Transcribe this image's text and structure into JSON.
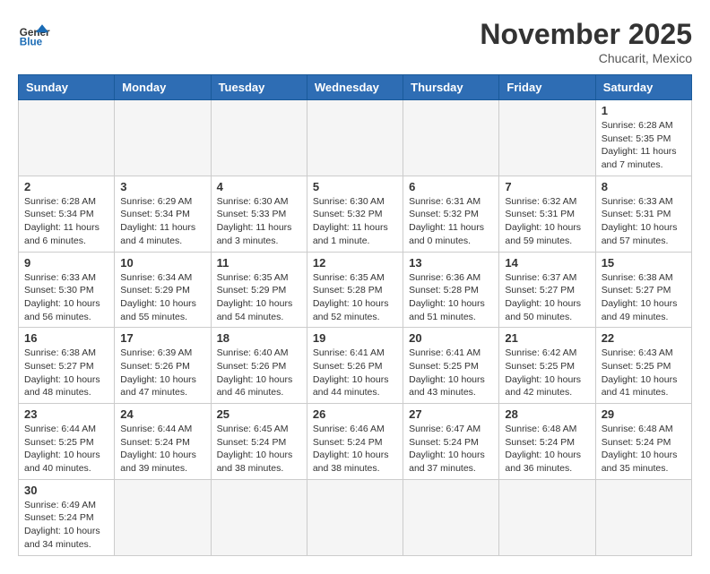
{
  "header": {
    "logo_general": "General",
    "logo_blue": "Blue",
    "month": "November 2025",
    "location": "Chucarit, Mexico"
  },
  "weekdays": [
    "Sunday",
    "Monday",
    "Tuesday",
    "Wednesday",
    "Thursday",
    "Friday",
    "Saturday"
  ],
  "weeks": [
    [
      {
        "day": "",
        "info": ""
      },
      {
        "day": "",
        "info": ""
      },
      {
        "day": "",
        "info": ""
      },
      {
        "day": "",
        "info": ""
      },
      {
        "day": "",
        "info": ""
      },
      {
        "day": "",
        "info": ""
      },
      {
        "day": "1",
        "info": "Sunrise: 6:28 AM\nSunset: 5:35 PM\nDaylight: 11 hours and 7 minutes."
      }
    ],
    [
      {
        "day": "2",
        "info": "Sunrise: 6:28 AM\nSunset: 5:34 PM\nDaylight: 11 hours and 6 minutes."
      },
      {
        "day": "3",
        "info": "Sunrise: 6:29 AM\nSunset: 5:34 PM\nDaylight: 11 hours and 4 minutes."
      },
      {
        "day": "4",
        "info": "Sunrise: 6:30 AM\nSunset: 5:33 PM\nDaylight: 11 hours and 3 minutes."
      },
      {
        "day": "5",
        "info": "Sunrise: 6:30 AM\nSunset: 5:32 PM\nDaylight: 11 hours and 1 minute."
      },
      {
        "day": "6",
        "info": "Sunrise: 6:31 AM\nSunset: 5:32 PM\nDaylight: 11 hours and 0 minutes."
      },
      {
        "day": "7",
        "info": "Sunrise: 6:32 AM\nSunset: 5:31 PM\nDaylight: 10 hours and 59 minutes."
      },
      {
        "day": "8",
        "info": "Sunrise: 6:33 AM\nSunset: 5:31 PM\nDaylight: 10 hours and 57 minutes."
      }
    ],
    [
      {
        "day": "9",
        "info": "Sunrise: 6:33 AM\nSunset: 5:30 PM\nDaylight: 10 hours and 56 minutes."
      },
      {
        "day": "10",
        "info": "Sunrise: 6:34 AM\nSunset: 5:29 PM\nDaylight: 10 hours and 55 minutes."
      },
      {
        "day": "11",
        "info": "Sunrise: 6:35 AM\nSunset: 5:29 PM\nDaylight: 10 hours and 54 minutes."
      },
      {
        "day": "12",
        "info": "Sunrise: 6:35 AM\nSunset: 5:28 PM\nDaylight: 10 hours and 52 minutes."
      },
      {
        "day": "13",
        "info": "Sunrise: 6:36 AM\nSunset: 5:28 PM\nDaylight: 10 hours and 51 minutes."
      },
      {
        "day": "14",
        "info": "Sunrise: 6:37 AM\nSunset: 5:27 PM\nDaylight: 10 hours and 50 minutes."
      },
      {
        "day": "15",
        "info": "Sunrise: 6:38 AM\nSunset: 5:27 PM\nDaylight: 10 hours and 49 minutes."
      }
    ],
    [
      {
        "day": "16",
        "info": "Sunrise: 6:38 AM\nSunset: 5:27 PM\nDaylight: 10 hours and 48 minutes."
      },
      {
        "day": "17",
        "info": "Sunrise: 6:39 AM\nSunset: 5:26 PM\nDaylight: 10 hours and 47 minutes."
      },
      {
        "day": "18",
        "info": "Sunrise: 6:40 AM\nSunset: 5:26 PM\nDaylight: 10 hours and 46 minutes."
      },
      {
        "day": "19",
        "info": "Sunrise: 6:41 AM\nSunset: 5:26 PM\nDaylight: 10 hours and 44 minutes."
      },
      {
        "day": "20",
        "info": "Sunrise: 6:41 AM\nSunset: 5:25 PM\nDaylight: 10 hours and 43 minutes."
      },
      {
        "day": "21",
        "info": "Sunrise: 6:42 AM\nSunset: 5:25 PM\nDaylight: 10 hours and 42 minutes."
      },
      {
        "day": "22",
        "info": "Sunrise: 6:43 AM\nSunset: 5:25 PM\nDaylight: 10 hours and 41 minutes."
      }
    ],
    [
      {
        "day": "23",
        "info": "Sunrise: 6:44 AM\nSunset: 5:25 PM\nDaylight: 10 hours and 40 minutes."
      },
      {
        "day": "24",
        "info": "Sunrise: 6:44 AM\nSunset: 5:24 PM\nDaylight: 10 hours and 39 minutes."
      },
      {
        "day": "25",
        "info": "Sunrise: 6:45 AM\nSunset: 5:24 PM\nDaylight: 10 hours and 38 minutes."
      },
      {
        "day": "26",
        "info": "Sunrise: 6:46 AM\nSunset: 5:24 PM\nDaylight: 10 hours and 38 minutes."
      },
      {
        "day": "27",
        "info": "Sunrise: 6:47 AM\nSunset: 5:24 PM\nDaylight: 10 hours and 37 minutes."
      },
      {
        "day": "28",
        "info": "Sunrise: 6:48 AM\nSunset: 5:24 PM\nDaylight: 10 hours and 36 minutes."
      },
      {
        "day": "29",
        "info": "Sunrise: 6:48 AM\nSunset: 5:24 PM\nDaylight: 10 hours and 35 minutes."
      }
    ],
    [
      {
        "day": "30",
        "info": "Sunrise: 6:49 AM\nSunset: 5:24 PM\nDaylight: 10 hours and 34 minutes."
      },
      {
        "day": "",
        "info": ""
      },
      {
        "day": "",
        "info": ""
      },
      {
        "day": "",
        "info": ""
      },
      {
        "day": "",
        "info": ""
      },
      {
        "day": "",
        "info": ""
      },
      {
        "day": "",
        "info": ""
      }
    ]
  ]
}
